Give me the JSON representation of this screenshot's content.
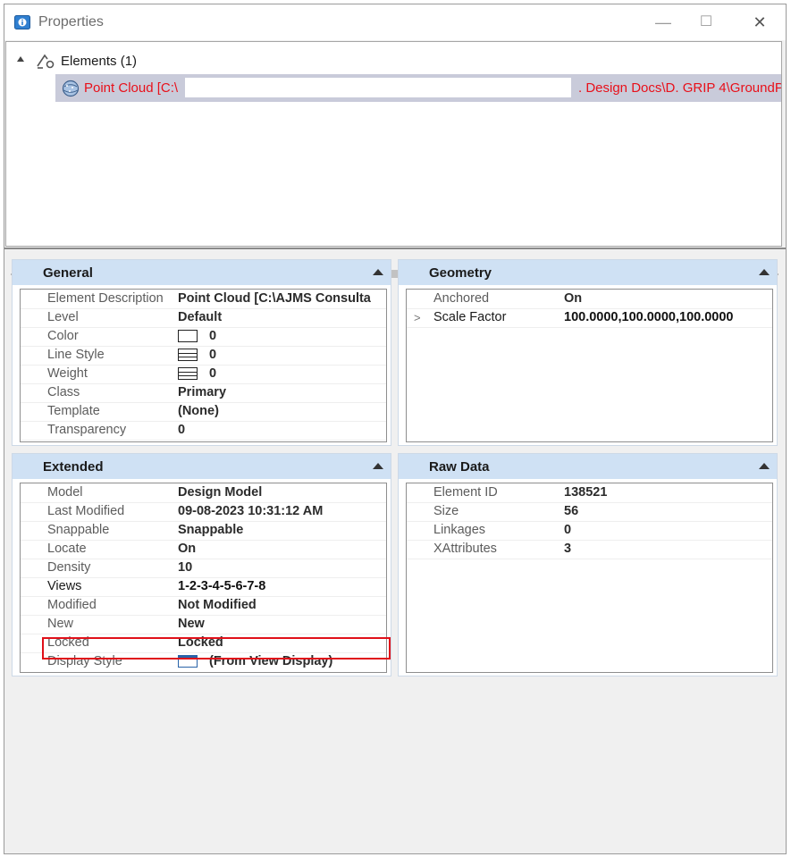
{
  "window": {
    "title": "Properties",
    "controls": {
      "minimize": "—",
      "maximize": "☐",
      "close": "✕"
    }
  },
  "tree": {
    "root_label": "Elements (1)",
    "child_label_start": "Point Cloud [C:\\",
    "child_label_end": ". Design Docs\\D. GRIP 4\\GroundP..."
  },
  "panels": {
    "general": {
      "title": "General",
      "rows": [
        {
          "name": "Element Description",
          "value": "Point Cloud [C:\\AJMS Consulta"
        },
        {
          "name": "Level",
          "value": "Default"
        },
        {
          "name": "Color",
          "value": "0"
        },
        {
          "name": "Line Style",
          "value": "0"
        },
        {
          "name": "Weight",
          "value": "0"
        },
        {
          "name": "Class",
          "value": "Primary"
        },
        {
          "name": "Template",
          "value": "(None)"
        },
        {
          "name": "Transparency",
          "value": "0"
        }
      ]
    },
    "geometry": {
      "title": "Geometry",
      "rows": [
        {
          "name": "Anchored",
          "value": "On"
        },
        {
          "name": "Scale Factor",
          "value": "100.0000,100.0000,100.0000"
        }
      ]
    },
    "extended": {
      "title": "Extended",
      "rows": [
        {
          "name": "Model",
          "value": "Design Model"
        },
        {
          "name": "Last Modified",
          "value": "09-08-2023 10:31:12 AM"
        },
        {
          "name": "Snappable",
          "value": "Snappable"
        },
        {
          "name": "Locate",
          "value": "On"
        },
        {
          "name": "Density",
          "value": "10"
        },
        {
          "name": "Views",
          "value": "1-2-3-4-5-6-7-8"
        },
        {
          "name": "Modified",
          "value": "Not Modified"
        },
        {
          "name": "New",
          "value": "New"
        },
        {
          "name": "Locked",
          "value": "Locked"
        },
        {
          "name": "Display Style",
          "value": "(From View Display)"
        }
      ]
    },
    "raw_data": {
      "title": "Raw Data",
      "rows": [
        {
          "name": "Element ID",
          "value": "138521"
        },
        {
          "name": "Size",
          "value": "56"
        },
        {
          "name": "Linkages",
          "value": "0"
        },
        {
          "name": "XAttributes",
          "value": "3"
        }
      ]
    }
  },
  "colors": {
    "selection_text": "#e8101a",
    "panel_header": "#cfe1f4",
    "highlight_box": "#e01019"
  }
}
